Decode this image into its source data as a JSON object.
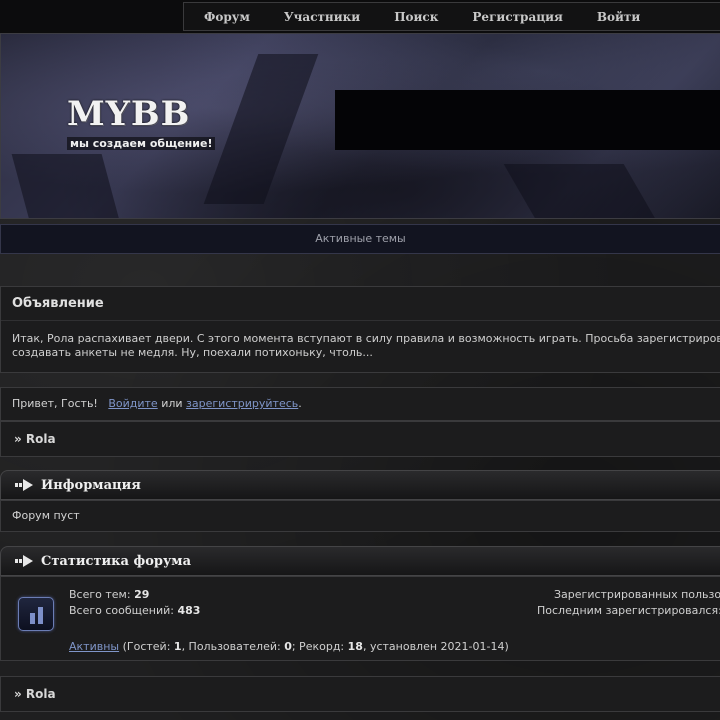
{
  "nav": {
    "items": [
      "Форум",
      "Участники",
      "Поиск",
      "Регистрация",
      "Войти"
    ]
  },
  "banner": {
    "logo_text": "MYBB",
    "logo_tagline": "мы создаем общение!"
  },
  "active_topics": {
    "label": "Активные темы"
  },
  "announcement": {
    "title": "Объявление",
    "text_line1": "Итак, Рола распахивает двери. С этого момента вступают в силу правила и возможность играть. Просьба зарегистриров",
    "text_line2": "создавать анкеты не медля. Ну, поехали потихоньку, чтоль..."
  },
  "welcome": {
    "greeting": "Привет, Гость!",
    "login_link": "Войдите",
    "or": "или",
    "register_link": "зарегистрируйтесь",
    "period": "."
  },
  "breadcrumb": {
    "text": "» Rola"
  },
  "info": {
    "title": "Информация",
    "text": "Форум пуст"
  },
  "stats": {
    "title": "Статистика форума",
    "topics_label": "Всего тем:",
    "topics_value": "29",
    "posts_label": "Всего сообщений:",
    "posts_value": "483",
    "registered_label": "Зарегистрированных пользо",
    "last_registered_label": "Последним зарегистрировался:",
    "active_link": "Активны",
    "guests_label": "(Гостей:",
    "guests_value": "1",
    "users_label": ", Пользователей:",
    "users_value": "0",
    "record_label": "; Рекорд:",
    "record_value": "18",
    "record_date": ", установлен 2021-01-14)"
  },
  "breadcrumb_bottom": {
    "text": "» Rola"
  },
  "colors": {
    "accent_link": "#7f95c8",
    "background": "#1f1f20",
    "panel": "#1c1c1d"
  },
  "icons": {
    "category_arrow": "arrow-right-icon",
    "stats": "bar-chart-icon"
  }
}
